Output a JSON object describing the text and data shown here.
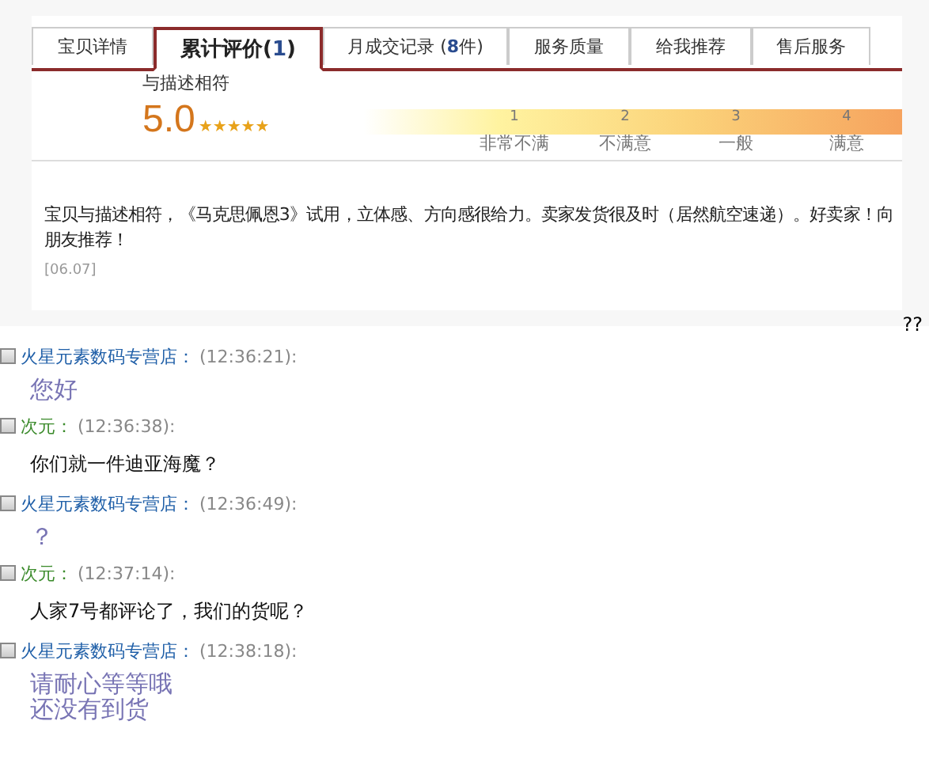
{
  "tabs": [
    {
      "label": "宝贝详情",
      "selected": false
    },
    {
      "label": "累计评价(**1**)",
      "selected": true
    },
    {
      "label": "月成交记录 (**8**件)",
      "selected": false
    },
    {
      "label": "服务质量",
      "selected": false
    },
    {
      "label": "给我推荐",
      "selected": false
    },
    {
      "label": "售后服务",
      "selected": false
    }
  ],
  "rating": {
    "label": "与描述相符",
    "score": "5.0",
    "stars": 5,
    "scale": [
      {
        "number": "1",
        "label": "非常不满"
      },
      {
        "number": "2",
        "label": "不满意"
      },
      {
        "number": "3",
        "label": "一般"
      },
      {
        "number": "4",
        "label": "满意"
      }
    ]
  },
  "review": {
    "text": "宝贝与描述相符，《马克思佩恩3》试用，立体感、方向感很给力。卖家发货很及时（居然航空速递）。好卖家！向朋友推荐！",
    "date": "[06.07]"
  },
  "stray_text": "??",
  "messages": [
    {
      "kind": "seller",
      "checked": false,
      "sender": "火星元素数码专营店：",
      "time": "(12:36:21):",
      "lines": [
        "您好"
      ]
    },
    {
      "kind": "buyer",
      "checked": false,
      "sender": "次元：",
      "time": "(12:36:38):",
      "lines": [
        "你们就一件迪亚海魔？"
      ]
    },
    {
      "kind": "seller",
      "checked": false,
      "sender": "火星元素数码专营店：",
      "time": "(12:36:49):",
      "lines": [
        "？"
      ]
    },
    {
      "kind": "buyer",
      "checked": false,
      "sender": "次元：",
      "time": "(12:37:14):",
      "lines": [
        "人家7号都评论了，我们的货呢？"
      ]
    },
    {
      "kind": "seller",
      "checked": false,
      "sender": "火星元素数码专营店：",
      "time": "(12:38:18):",
      "lines": [
        "请耐心等等哦",
        "还没有到货"
      ]
    }
  ]
}
